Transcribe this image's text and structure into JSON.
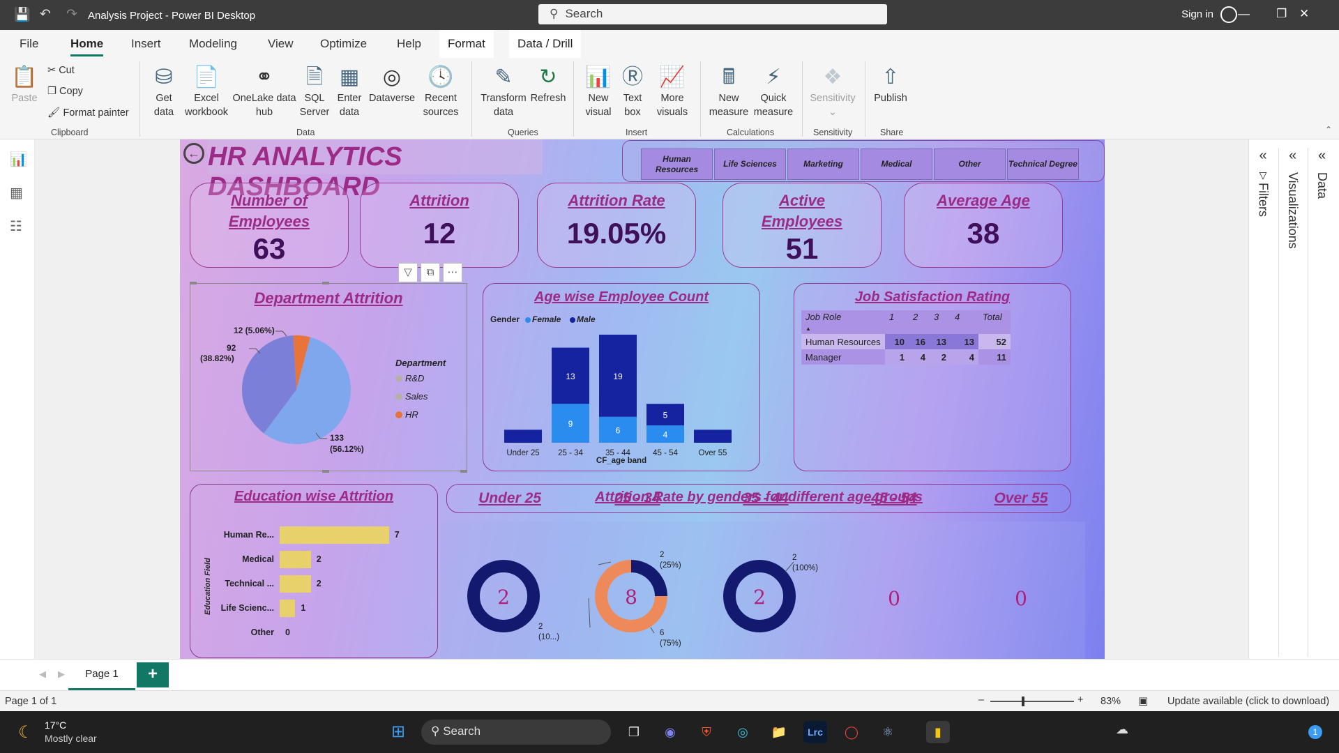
{
  "window": {
    "title": "Analysis Project - Power BI Desktop",
    "search_placeholder": "Search",
    "sign_in": "Sign in"
  },
  "menu": {
    "file": "File",
    "home": "Home",
    "insert": "Insert",
    "modeling": "Modeling",
    "view": "View",
    "optimize": "Optimize",
    "help": "Help",
    "format": "Format",
    "data_drill": "Data / Drill"
  },
  "ribbon": {
    "paste": "Paste",
    "cut": "Cut",
    "copy": "Copy",
    "format_painter": "Format painter",
    "clipboard": "Clipboard",
    "get_data_1": "Get",
    "get_data_2": "data",
    "excel_1": "Excel",
    "excel_2": "workbook",
    "onelake_1": "OneLake data",
    "onelake_2": "hub",
    "sql_1": "SQL",
    "sql_2": "Server",
    "enter_1": "Enter",
    "enter_2": "data",
    "dataverse": "Dataverse",
    "recent_1": "Recent",
    "recent_2": "sources",
    "data_group": "Data",
    "transform_1": "Transform",
    "transform_2": "data",
    "refresh": "Refresh",
    "queries": "Queries",
    "newvisual_1": "New",
    "newvisual_2": "visual",
    "textbox_1": "Text",
    "textbox_2": "box",
    "morevis_1": "More",
    "morevis_2": "visuals",
    "insert_group": "Insert",
    "newmeasure_1": "New",
    "newmeasure_2": "measure",
    "quick_1": "Quick",
    "quick_2": "measure",
    "calculations": "Calculations",
    "sensitivity": "Sensitivity",
    "sensitivity_group": "Sensitivity",
    "publish": "Publish",
    "share": "Share"
  },
  "panes": {
    "filters": "Filters",
    "visualizations": "Visualizations",
    "data": "Data"
  },
  "dashboard": {
    "title": "HR ANALYTICS DASHBOARD",
    "slicers": [
      "Human Resources",
      "Life Sciences",
      "Marketing",
      "Medical",
      "Other",
      "Technical Degree"
    ],
    "kpis": [
      {
        "label": "Number of Employees",
        "value": "63"
      },
      {
        "label": "Attrition",
        "value": "12"
      },
      {
        "label": "Attrition Rate",
        "value": "19.05%"
      },
      {
        "label": "Active Employees",
        "value": "51"
      },
      {
        "label": "Average Age",
        "value": "38"
      }
    ],
    "dept_attrition": {
      "title": "Department Attrition",
      "legend_title": "Department",
      "legend": [
        "R&D",
        "Sales",
        "HR"
      ],
      "labels": {
        "hr": "12 (5.06%)",
        "a_val": "92",
        "a_pct": "(38.82%)",
        "b_val": "133",
        "b_pct": "(56.12%)"
      }
    },
    "age_count": {
      "title": "Age wise Employee Count",
      "legend_title": "Gender",
      "female": "Female",
      "male": "Male",
      "xlabel": "CF_age band"
    },
    "job_sat": {
      "title": "Job Satisfaction Rating",
      "headers": [
        "Job Role",
        "1",
        "2",
        "3",
        "4",
        "Total"
      ],
      "rows": [
        [
          "Human Resources",
          "10",
          "16",
          "13",
          "13",
          "52"
        ],
        [
          "Manager",
          "1",
          "4",
          "2",
          "4",
          "11"
        ]
      ]
    },
    "education": {
      "title": "Education wise Attrition",
      "axis": "Education Field"
    },
    "gender_age": {
      "title": "Attrition Rate by genders for different age groups",
      "groups": [
        "Under 25",
        "25 - 34",
        "35 - 44",
        "45 - 54",
        "Over 55"
      ],
      "centers": [
        "2",
        "8",
        "2",
        "0",
        "0"
      ],
      "labels": {
        "g1": "2",
        "g1b": "(10...)",
        "g2a": "2",
        "g2b": "(25%)",
        "g2c": "6",
        "g2d": "(75%)",
        "g3a": "2",
        "g3b": "(100%)"
      }
    }
  },
  "chart_data": [
    {
      "type": "pie",
      "title": "Department Attrition",
      "categories": [
        "R&D",
        "Sales",
        "HR"
      ],
      "values": [
        133,
        92,
        12
      ],
      "percent": [
        56.12,
        38.82,
        5.06
      ],
      "colors": [
        "#7fa7ee",
        "#7b7fd8",
        "#e8743b"
      ]
    },
    {
      "type": "bar",
      "title": "Age wise Employee Count",
      "xlabel": "CF_age band",
      "categories": [
        "Under 25",
        "25 - 34",
        "35 - 44",
        "45 - 54",
        "Over 55"
      ],
      "series": [
        {
          "name": "Female",
          "values": [
            0,
            9,
            6,
            4,
            0
          ],
          "color": "#2b8cf0"
        },
        {
          "name": "Male",
          "values": [
            3,
            13,
            19,
            5,
            3
          ],
          "color": "#1523a0"
        }
      ]
    },
    {
      "type": "bar",
      "title": "Education wise Attrition",
      "ylabel": "Education Field",
      "categories": [
        "Human Re...",
        "Medical",
        "Technical ...",
        "Life Scienc...",
        "Other"
      ],
      "values": [
        7,
        2,
        2,
        1,
        0
      ],
      "color": "#e8d06a"
    },
    {
      "type": "pie",
      "title": "Attrition Rate by genders for different age groups",
      "categories": [
        "Under 25",
        "25 - 34",
        "35 - 44",
        "45 - 54",
        "Over 55"
      ],
      "series": [
        {
          "name": "Female",
          "values": [
            0,
            6,
            0,
            0,
            0
          ],
          "color": "#ee8a5a"
        },
        {
          "name": "Male",
          "values": [
            2,
            2,
            2,
            0,
            0
          ],
          "color": "#12196e"
        }
      ]
    }
  ],
  "tabs": {
    "page1": "Page 1",
    "add": "+"
  },
  "status": {
    "page": "Page 1 of 1",
    "zoom": "83%",
    "update": "Update available (click to download)"
  },
  "taskbar": {
    "temp": "17°C",
    "weather": "Mostly clear",
    "search": "Search",
    "notif": "1"
  }
}
